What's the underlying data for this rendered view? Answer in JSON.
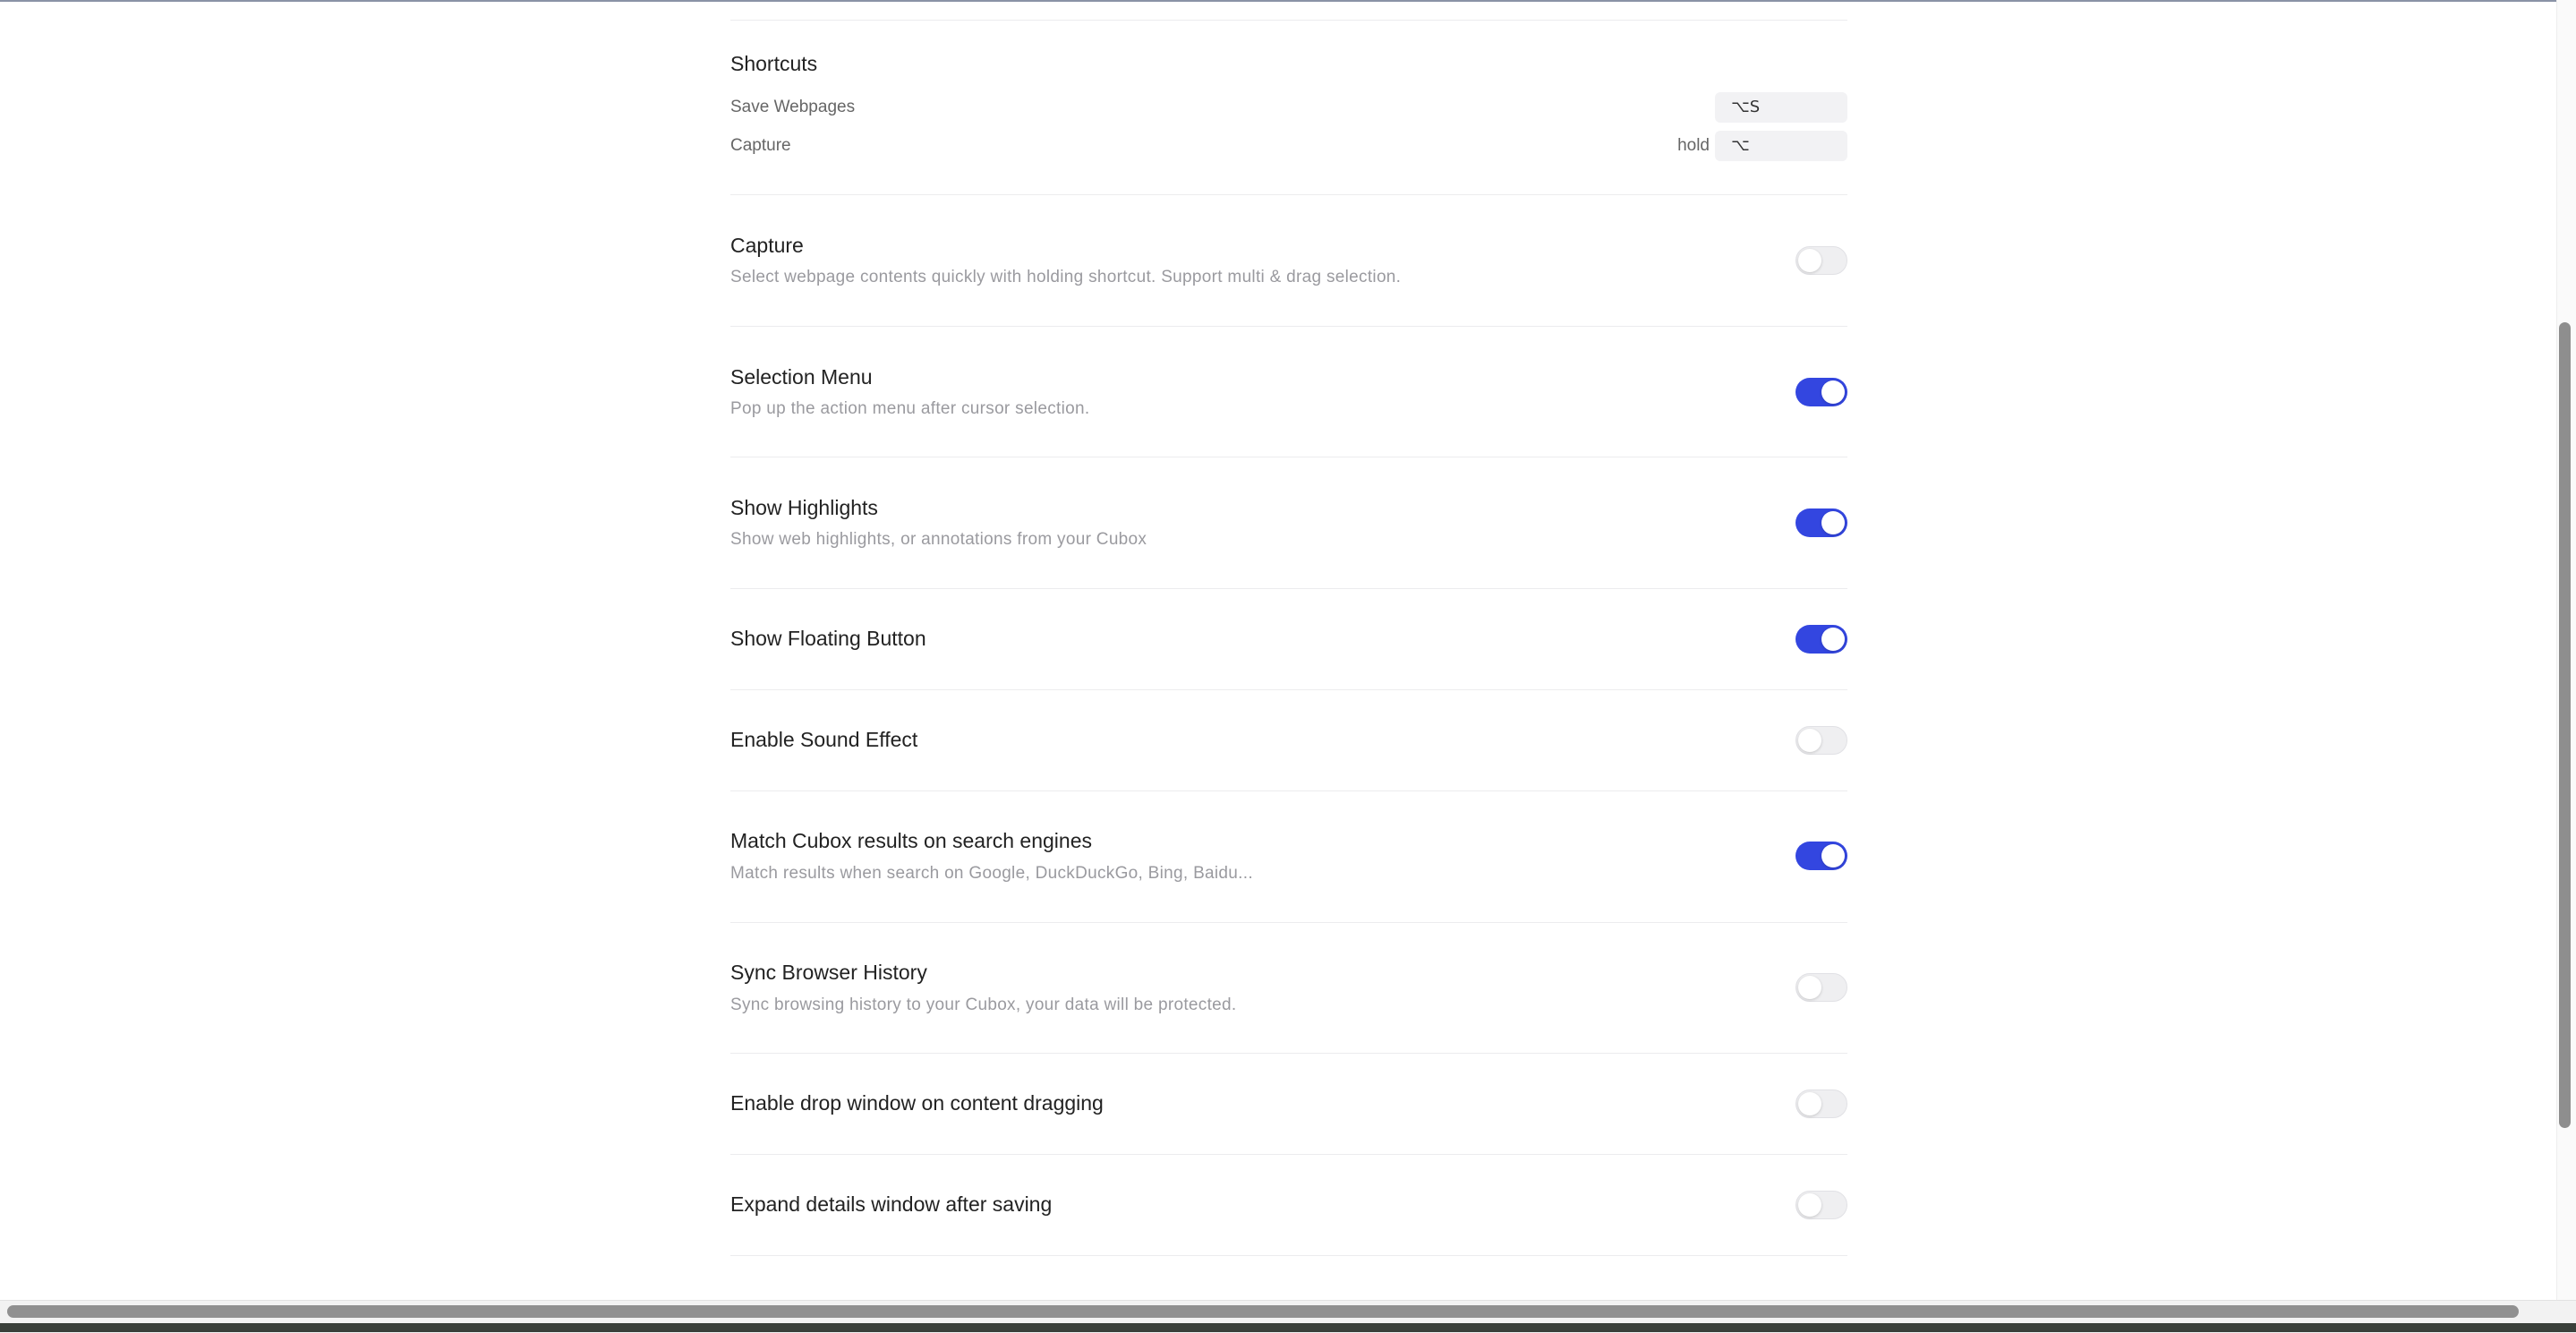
{
  "shortcuts": {
    "title": "Shortcuts",
    "items": [
      {
        "label": "Save Webpages",
        "prefix": "",
        "key": "⌥S"
      },
      {
        "label": "Capture",
        "prefix": "hold",
        "key": "⌥"
      }
    ]
  },
  "settings": [
    {
      "title": "Capture",
      "description": "Select webpage contents quickly with holding shortcut. Support multi & drag selection.",
      "enabled": false
    },
    {
      "title": "Selection Menu",
      "description": "Pop up the action menu after cursor selection.",
      "enabled": true
    },
    {
      "title": "Show Highlights",
      "description": "Show web highlights, or annotations from your Cubox",
      "enabled": true
    },
    {
      "title": "Show Floating Button",
      "description": "",
      "enabled": true
    },
    {
      "title": "Enable Sound Effect",
      "description": "",
      "enabled": false
    },
    {
      "title": "Match Cubox results on search engines",
      "description": "Match results when search on Google, DuckDuckGo, Bing, Baidu...",
      "enabled": true
    },
    {
      "title": "Sync Browser History",
      "description": "Sync browsing history to your Cubox, your data will be protected.",
      "enabled": false
    },
    {
      "title": "Enable drop window on content dragging",
      "description": "",
      "enabled": false
    },
    {
      "title": "Expand details window after saving",
      "description": "",
      "enabled": false
    }
  ],
  "colors": {
    "toggle_on": "#3346e0",
    "toggle_off": "#efeff1"
  }
}
